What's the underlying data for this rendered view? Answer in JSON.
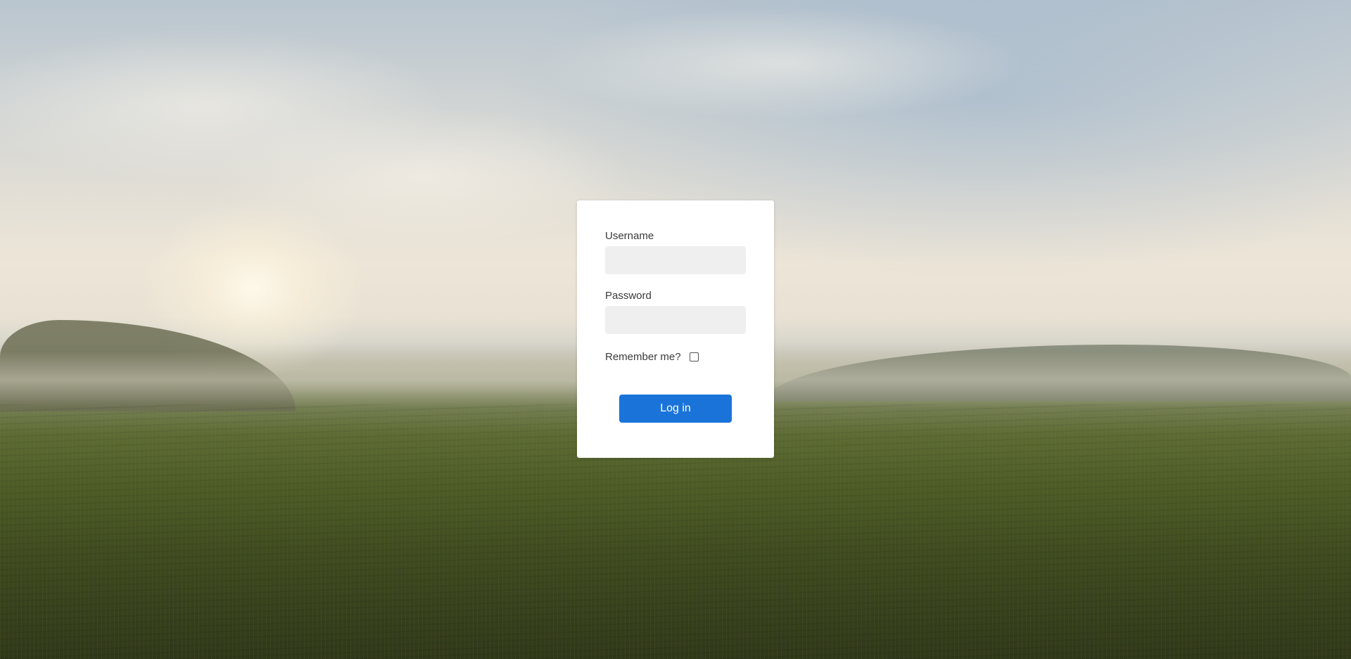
{
  "background": {
    "description_icon": "landscape-photo"
  },
  "login": {
    "username_label": "Username",
    "username_value": "",
    "password_label": "Password",
    "password_value": "",
    "remember_label": "Remember me?",
    "remember_checked": false,
    "submit_label": "Log in"
  },
  "colors": {
    "card": "#ffffff",
    "input_bg": "#efefef",
    "button": "#1a73d9",
    "button_text": "#ffffff"
  }
}
